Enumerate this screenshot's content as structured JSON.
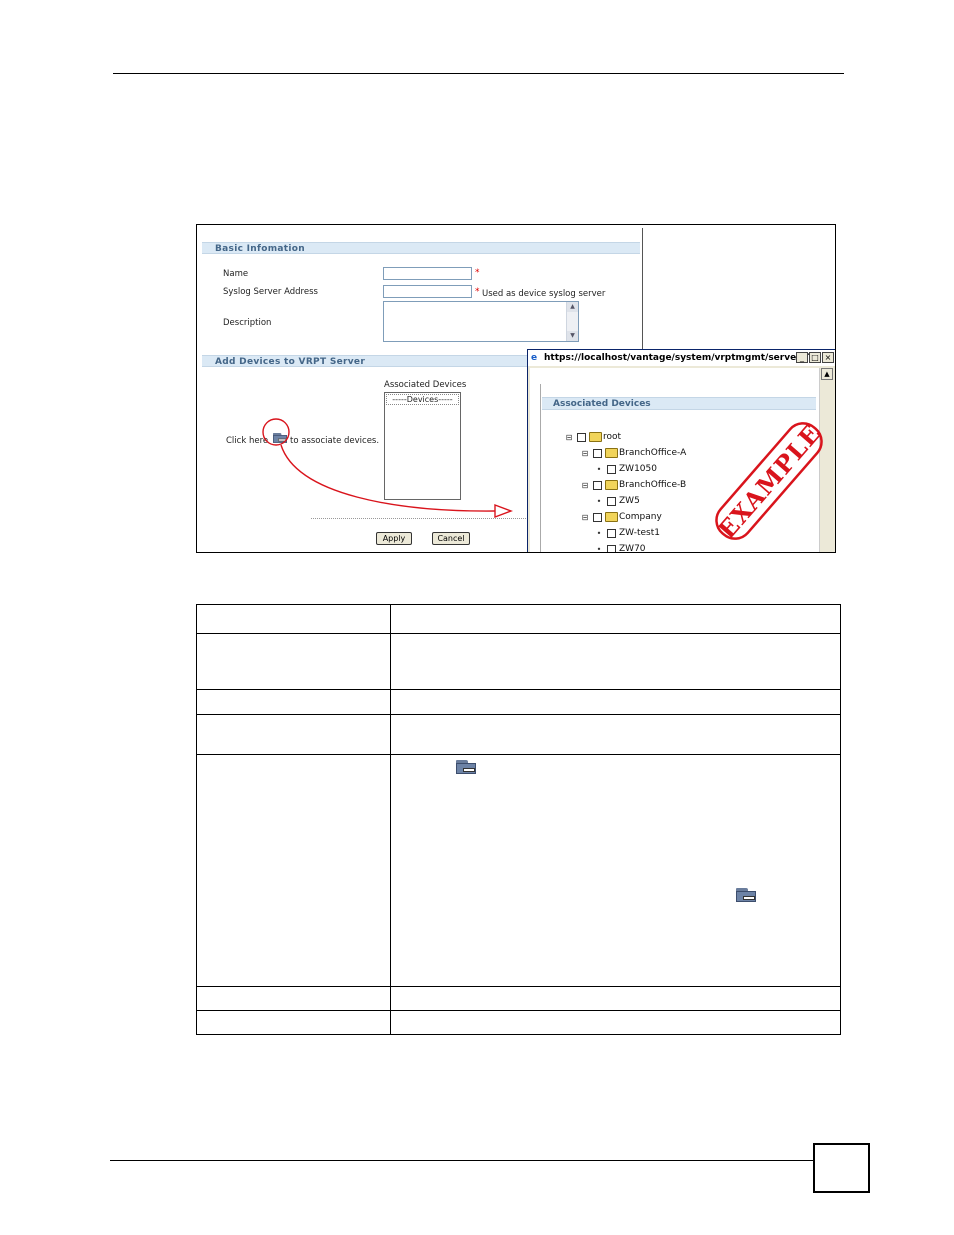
{
  "screenshot": {
    "basic_section": {
      "title": "Basic Infomation",
      "name_label": "Name",
      "syslog_label": "Syslog Server Address",
      "syslog_hint": "Used as device syslog server",
      "description_label": "Description",
      "required_mark": "*"
    },
    "devices_section": {
      "title": "Add Devices to VRPT Server",
      "associated_label": "Associated Devices",
      "listbox_item": "-----Devices-----",
      "click_before": "Click here",
      "click_after": "to associate devices."
    },
    "buttons": {
      "apply": "Apply",
      "cancel": "Cancel"
    },
    "popup": {
      "title": "https://localhost/vantage/system/vrptmgmt/server/T...",
      "min": "_",
      "max": "□",
      "close": "×",
      "section_title": "Associated Devices",
      "tree": [
        {
          "ctrl": "⊟",
          "label": "root",
          "folder": true,
          "level": 0
        },
        {
          "ctrl": "⊟",
          "label": "BranchOffice-A",
          "folder": true,
          "level": 1
        },
        {
          "ctrl": "•",
          "label": "ZW1050",
          "folder": false,
          "level": 2
        },
        {
          "ctrl": "⊟",
          "label": "BranchOffice-B",
          "folder": true,
          "level": 1
        },
        {
          "ctrl": "•",
          "label": "ZW5",
          "folder": false,
          "level": 2
        },
        {
          "ctrl": "⊟",
          "label": "Company",
          "folder": true,
          "level": 1
        },
        {
          "ctrl": "•",
          "label": "ZW-test1",
          "folder": false,
          "level": 2
        },
        {
          "ctrl": "•",
          "label": "ZW70",
          "folder": false,
          "level": 2
        }
      ]
    },
    "stamp": "EXAMPLE",
    "colors": {
      "stamp": "#d9141c",
      "section_bar": "#dbe9f5",
      "section_text": "#446688"
    }
  }
}
